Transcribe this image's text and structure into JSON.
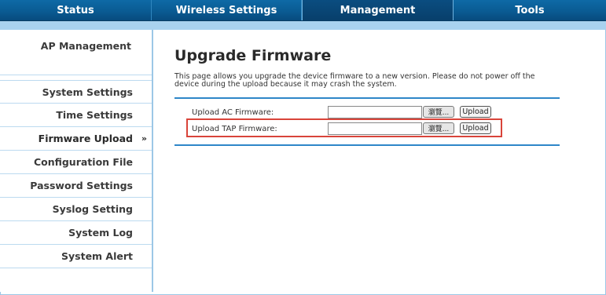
{
  "nav": {
    "tabs": [
      {
        "label": "Status"
      },
      {
        "label": "Wireless Settings"
      },
      {
        "label": "Management"
      },
      {
        "label": "Tools"
      }
    ]
  },
  "sidebar": {
    "header": "AP Management",
    "items": [
      {
        "label": "System Settings"
      },
      {
        "label": "Time Settings"
      },
      {
        "label": "Firmware Upload",
        "arrow": "»"
      },
      {
        "label": "Configuration File"
      },
      {
        "label": "Password Settings"
      },
      {
        "label": "Syslog Setting"
      },
      {
        "label": "System Log"
      },
      {
        "label": "System Alert"
      }
    ]
  },
  "main": {
    "title": "Upgrade Firmware",
    "description": "This page allows you upgrade the device firmware to a new version. Please do not power off the device during the upload because it may crash the system.",
    "rows": [
      {
        "label": "Upload AC Firmware:",
        "browse_label": "瀏覽...",
        "upload_label": "Upload",
        "value": ""
      },
      {
        "label": "Upload TAP Firmware:",
        "browse_label": "瀏覽...",
        "upload_label": "Upload",
        "value": ""
      }
    ]
  },
  "colors": {
    "nav_bg": "#0a5b93",
    "accent_line": "#2e86c8",
    "highlight_border": "#d9443a"
  }
}
